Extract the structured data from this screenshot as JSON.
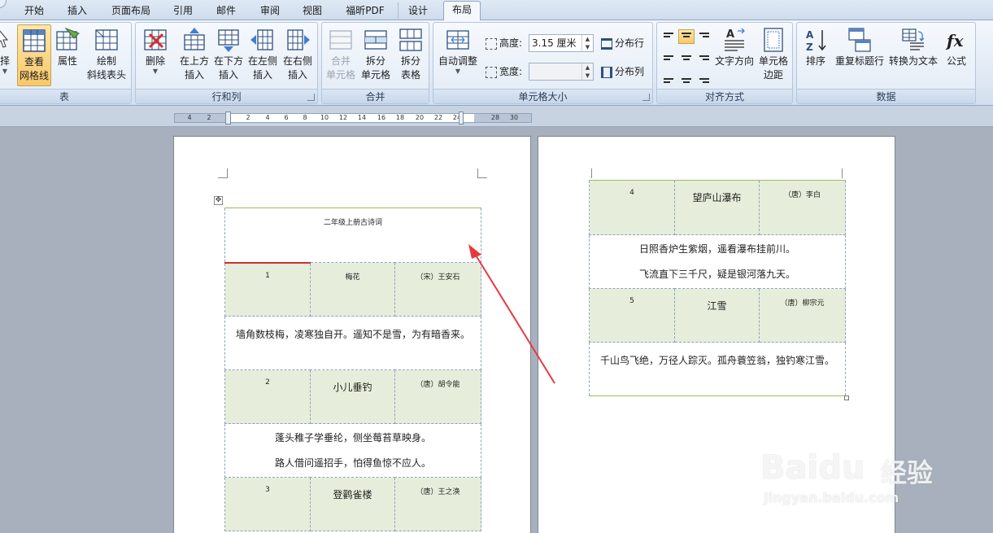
{
  "tabs": [
    {
      "label": "开始"
    },
    {
      "label": "插入"
    },
    {
      "label": "页面布局"
    },
    {
      "label": "引用"
    },
    {
      "label": "邮件"
    },
    {
      "label": "审阅"
    },
    {
      "label": "视图"
    },
    {
      "label": "福昕PDF"
    },
    {
      "label": "设计"
    },
    {
      "label": "布局",
      "active": true
    }
  ],
  "groups": {
    "table": {
      "label": "表",
      "select": "择",
      "view_gridlines_1": "查看",
      "view_gridlines_2": "网格线",
      "properties": "属性",
      "draw_diag_1": "绘制",
      "draw_diag_2": "斜线表头"
    },
    "rows_cols": {
      "label": "行和列",
      "delete": "删除",
      "insert_above_1": "在上方",
      "insert_above_2": "插入",
      "insert_below_1": "在下方",
      "insert_below_2": "插入",
      "insert_left_1": "在左侧",
      "insert_left_2": "插入",
      "insert_right_1": "在右侧",
      "insert_right_2": "插入"
    },
    "merge": {
      "label": "合并",
      "merge_cells_1": "合并",
      "merge_cells_2": "单元格",
      "split_cells_1": "拆分",
      "split_cells_2": "单元格",
      "split_table_1": "拆分",
      "split_table_2": "表格"
    },
    "cell_size": {
      "label": "单元格大小",
      "autofit": "自动调整",
      "height_label": "高度:",
      "height_value": "3.15 厘米",
      "width_label": "宽度:",
      "width_value": "",
      "distribute_rows": "分布行",
      "distribute_cols": "分布列"
    },
    "alignment": {
      "label": "对齐方式",
      "text_direction": "文字方向",
      "cell_margins_1": "单元格",
      "cell_margins_2": "边距"
    },
    "data": {
      "label": "数据",
      "sort": "排序",
      "repeat_header": "重复标题行",
      "convert_text": "转换为文本",
      "formula": "公式"
    }
  },
  "ruler": {
    "ticks": [
      "4",
      "2",
      "2",
      "4",
      "6",
      "8",
      "10",
      "12",
      "14",
      "16",
      "18",
      "20",
      "22",
      "24",
      "28",
      "30"
    ]
  },
  "document": {
    "page1": {
      "title": "二年级上册古诗词",
      "poems": [
        {
          "num": "1",
          "name": "梅花",
          "author": "（宋）王安石",
          "lines": [
            "墙角数枝梅，凌寒独自开。遥知不是雪，为有暗香来。"
          ]
        },
        {
          "num": "2",
          "name": "小儿垂钓",
          "author": "（唐）胡令能",
          "lines": [
            "蓬头稚子学垂纶，侧坐莓苔草映身。",
            "路人借问遥招手，怕得鱼惊不应人。"
          ]
        },
        {
          "num": "3",
          "name": "登鹳雀楼",
          "author": "（唐）王之涣",
          "lines": []
        }
      ]
    },
    "page2": {
      "poems": [
        {
          "num": "4",
          "name": "望庐山瀑布",
          "author": "（唐）李白",
          "lines": [
            "日照香炉生紫烟，遥看瀑布挂前川。",
            "飞流直下三千尺，疑是银河落九天。"
          ]
        },
        {
          "num": "5",
          "name": "江雪",
          "author": "（唐）柳宗元",
          "lines": [
            "千山鸟飞绝，万径人踪灭。孤舟蓑笠翁，独钓寒江雪。"
          ]
        }
      ]
    }
  },
  "watermark": {
    "brand": "Baidu",
    "cn": "经验",
    "url": "jingyan.baidu.com"
  },
  "colors": {
    "header_fill": "#e6eedb",
    "arrow": "#e8383d",
    "active_button": "#f8c86a"
  }
}
